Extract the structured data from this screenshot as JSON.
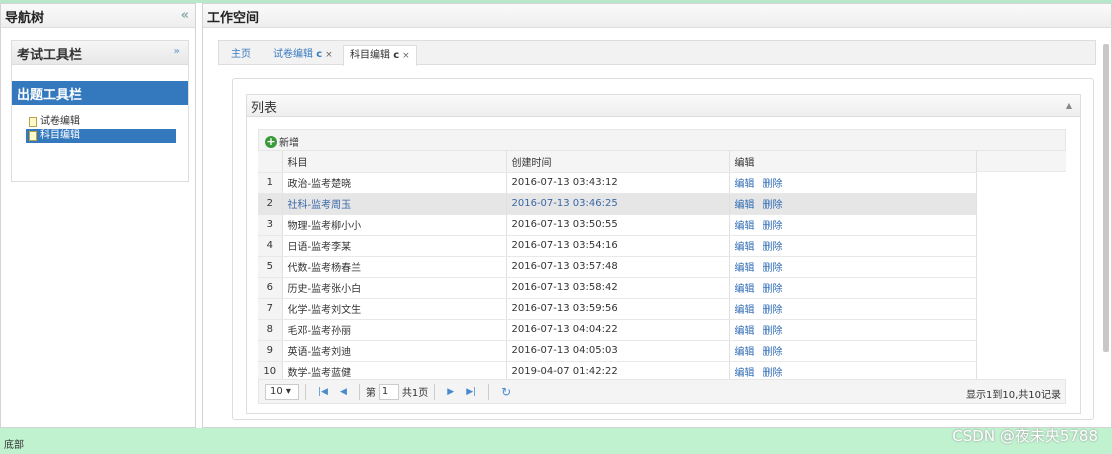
{
  "west": {
    "title": "导航树",
    "collapse": "«",
    "sections": [
      {
        "title": "考试工具栏",
        "toggle": "»"
      },
      {
        "title": "出题工具栏",
        "toggle": "«"
      }
    ],
    "tree": [
      "试卷编辑",
      "科目编辑"
    ]
  },
  "center": {
    "title": "工作空间",
    "tabs": [
      {
        "label": "主页"
      },
      {
        "label": "试卷编辑",
        "ico": "c",
        "close": "×"
      },
      {
        "label": "科目编辑",
        "ico": "c",
        "close": "×"
      }
    ],
    "panel_title": "列表",
    "add_label": "新增",
    "columns": [
      "科目",
      "创建时间",
      "编辑"
    ],
    "rows": [
      {
        "n": "1",
        "subject": "政治-监考楚晓",
        "time": "2016-07-13 03:43:12"
      },
      {
        "n": "2",
        "subject": "社科-监考周玉",
        "time": "2016-07-13 03:46:25"
      },
      {
        "n": "3",
        "subject": "物理-监考柳小小",
        "time": "2016-07-13 03:50:55"
      },
      {
        "n": "4",
        "subject": "日语-监考李某",
        "time": "2016-07-13 03:54:16"
      },
      {
        "n": "5",
        "subject": "代数-监考杨春兰",
        "time": "2016-07-13 03:57:48"
      },
      {
        "n": "6",
        "subject": "历史-监考张小白",
        "time": "2016-07-13 03:58:42"
      },
      {
        "n": "7",
        "subject": "化学-监考刘文生",
        "time": "2016-07-13 03:59:56"
      },
      {
        "n": "8",
        "subject": "毛邓-监考孙丽",
        "time": "2016-07-13 04:04:22"
      },
      {
        "n": "9",
        "subject": "英语-监考刘迪",
        "time": "2016-07-13 04:05:03"
      },
      {
        "n": "10",
        "subject": "数学-监考蓝健",
        "time": "2019-04-07 01:42:22"
      }
    ],
    "edit": "编辑",
    "delete": "删除",
    "pager": {
      "page_size": "10 ▾",
      "page_prefix": "第",
      "page": "1",
      "page_suffix": "共1页",
      "info": "显示1到10,共10记录"
    }
  },
  "footer": "底部",
  "watermark": "CSDN @夜未央5788"
}
